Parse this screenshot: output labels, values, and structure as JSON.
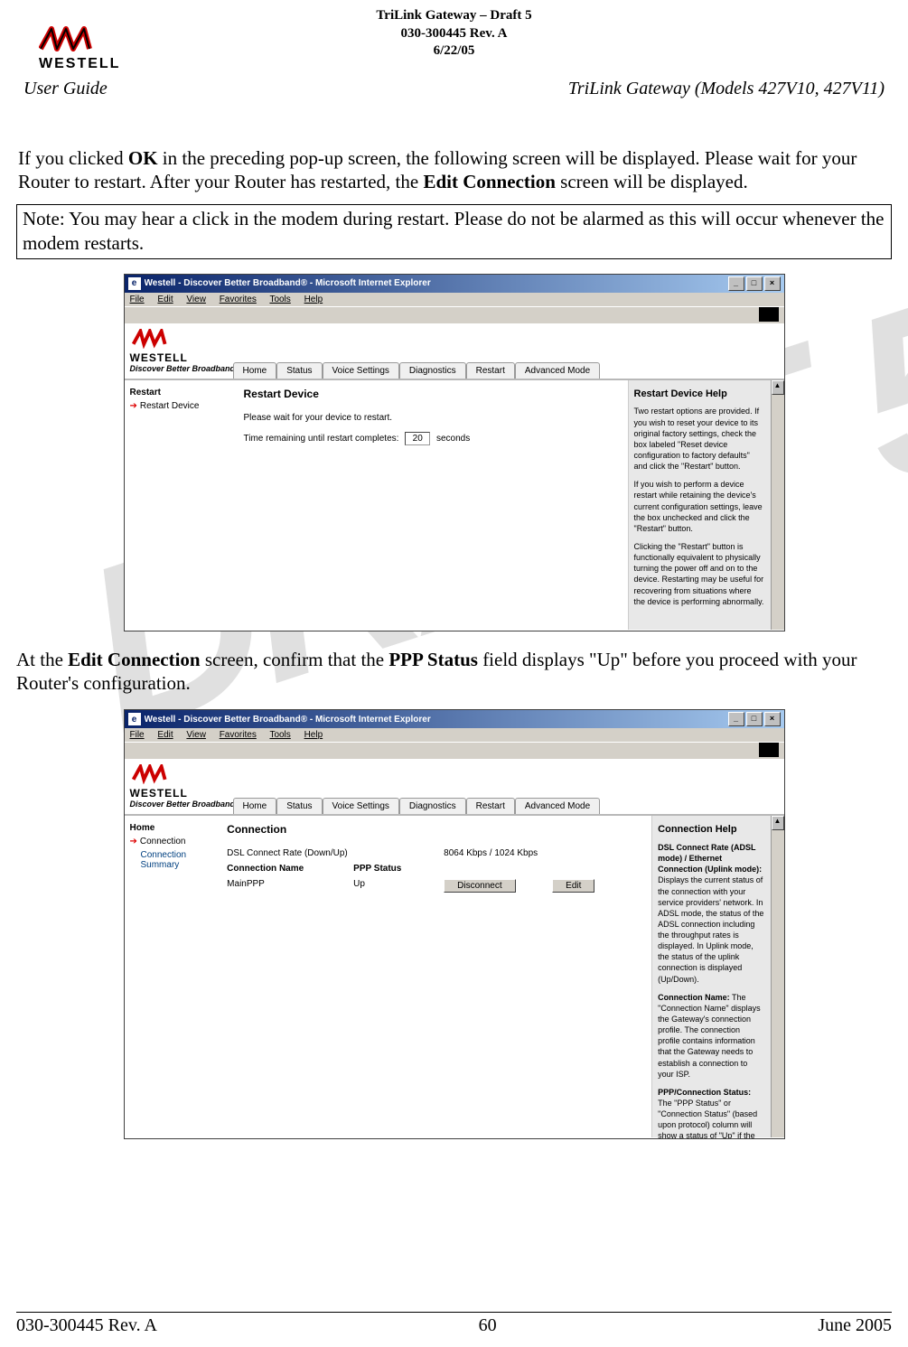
{
  "doc_header": {
    "line1": "TriLink Gateway – Draft 5",
    "line2": "030-300445 Rev. A",
    "line3": "6/22/05"
  },
  "brand_name": "WESTELL",
  "header_left": "User Guide",
  "header_right": "TriLink Gateway (Models 427V10, 427V11)",
  "para1_pre": "If you clicked ",
  "para1_bold1": "OK",
  "para1_mid1": " in the preceding pop-up screen, the following screen will be displayed. Please wait for your Router to restart. After your Router has restarted, the ",
  "para1_bold2": "Edit Connection",
  "para1_post": " screen will be displayed.",
  "note_text": "Note: You may hear a click in the modem during restart. Please do not be alarmed as this will occur whenever the modem restarts.",
  "ie_title": "Westell - Discover Better Broadband® - Microsoft Internet Explorer",
  "ie_menu": [
    "File",
    "Edit",
    "View",
    "Favorites",
    "Tools",
    "Help"
  ],
  "westell_tagline": "Discover Better Broadband",
  "tabs": [
    "Home",
    "Status",
    "Voice Settings",
    "Diagnostics",
    "Restart",
    "Advanced Mode"
  ],
  "screenshot1": {
    "left_head": "Restart",
    "left_item": "Restart Device",
    "main_head": "Restart Device",
    "msg1": "Please wait for your device to restart.",
    "msg2a": "Time remaining until restart completes:",
    "countdown": "20",
    "msg2b": "seconds",
    "help_title": "Restart Device Help",
    "help_p1": "Two restart options are provided. If you wish to reset your device to its original factory settings, check the box labeled \"Reset device configuration to factory defaults\" and click the \"Restart\" button.",
    "help_p2": "If you wish to perform a device restart while retaining the device's current configuration settings, leave the box unchecked and click the \"Restart\" button.",
    "help_p3": "Clicking the \"Restart\" button is functionally equivalent to physically turning the power off and on to the device. Restarting may be useful for recovering from situations where the device is performing abnormally."
  },
  "para2_pre": "At the ",
  "para2_bold1": "Edit Connection",
  "para2_mid": " screen, confirm that the ",
  "para2_bold2": "PPP Status",
  "para2_post": " field displays \"Up\" before you proceed with your Router's configuration.",
  "screenshot2": {
    "left_head": "Home",
    "left_item1": "Connection",
    "left_item2": "Connection Summary",
    "main_head": "Connection",
    "rate_label": "DSL Connect Rate (Down/Up)",
    "rate_value": "8064 Kbps / 1024 Kbps",
    "col1": "Connection Name",
    "col2": "PPP Status",
    "conn_name": "MainPPP",
    "ppp_status": "Up",
    "btn_disconnect": "Disconnect",
    "btn_edit": "Edit",
    "help_title": "Connection Help",
    "help_b1": "DSL Connect Rate (ADSL mode) / Ethernet Connection (Uplink mode):",
    "help_p1": " Displays the current status of the connection with your service providers' network. In ADSL mode, the status of the ADSL connection including the throughput rates is displayed. In Uplink mode, the status of the uplink connection is displayed (Up/Down).",
    "help_b2": "Connection Name:",
    "help_p2": " The \"Connection Name\" displays the Gateway's connection profile. The connection profile contains information that the Gateway needs to establish a connection to your ISP.",
    "help_b3": "PPP/Connection Status:",
    "help_p3": " The \"PPP Status\" or \"Connection Status\" (based upon protocol) column will show a status of \"Up\" if the gateway is currently using that profile to communicate"
  },
  "footer": {
    "left": "030-300445 Rev. A",
    "center": "60",
    "right": "June 2005"
  }
}
